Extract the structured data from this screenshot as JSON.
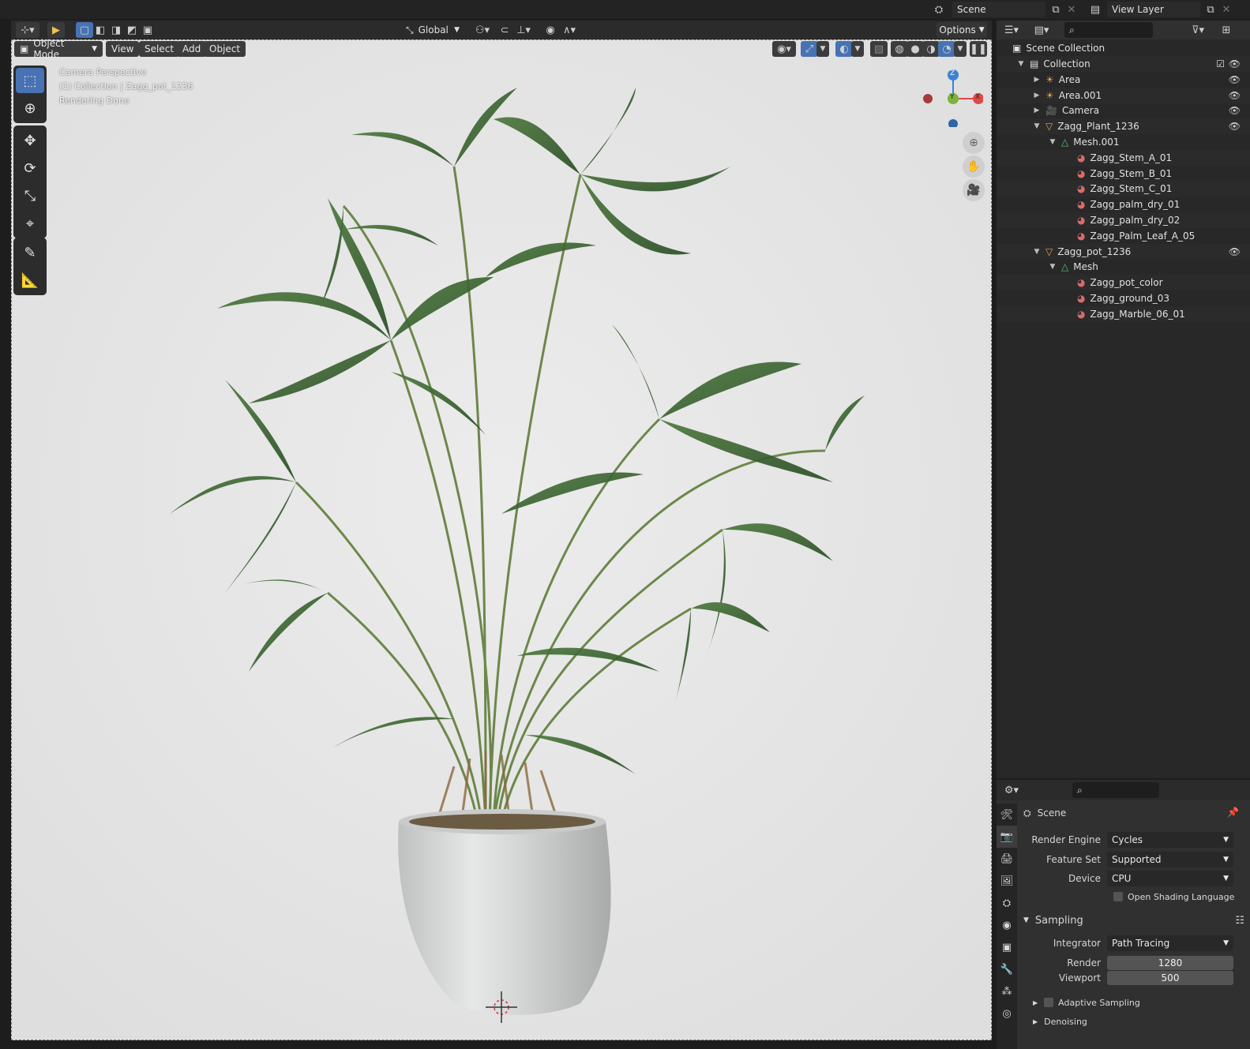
{
  "topbar": {
    "scene_label": "Scene",
    "view_layer_label": "View Layer"
  },
  "header": {
    "transform_orientation": "Global",
    "options_label": "Options"
  },
  "viewport_header": {
    "mode": "Object Mode",
    "menus": [
      "View",
      "Select",
      "Add",
      "Object"
    ]
  },
  "viewport": {
    "info_lines": [
      "Camera Perspective",
      "(1) Collection | Zagg_pot_1236",
      "Rendering Done"
    ],
    "gizmo": {
      "z": "Z",
      "y": "Y",
      "x": "X"
    }
  },
  "outliner": {
    "root": "Scene Collection",
    "rows": [
      {
        "label": "Collection",
        "indent": 1,
        "icon": "collection-icon",
        "expanded": true,
        "eye": true,
        "check": true
      },
      {
        "label": "Area",
        "indent": 2,
        "icon": "light-icon",
        "expanded": false,
        "eye": true
      },
      {
        "label": "Area.001",
        "indent": 2,
        "icon": "light-icon",
        "expanded": false,
        "eye": true
      },
      {
        "label": "Camera",
        "indent": 2,
        "icon": "camera-icon",
        "expanded": false,
        "eye": true
      },
      {
        "label": "Zagg_Plant_1236",
        "indent": 2,
        "icon": "mesh-object-icon",
        "expanded": true,
        "eye": true
      },
      {
        "label": "Mesh.001",
        "indent": 3,
        "icon": "mesh-data-icon",
        "expanded": true
      },
      {
        "label": "Zagg_Stem_A_01",
        "indent": 4,
        "icon": "material-icon"
      },
      {
        "label": "Zagg_Stem_B_01",
        "indent": 4,
        "icon": "material-icon"
      },
      {
        "label": "Zagg_Stem_C_01",
        "indent": 4,
        "icon": "material-icon"
      },
      {
        "label": "Zagg_palm_dry_01",
        "indent": 4,
        "icon": "material-icon"
      },
      {
        "label": "Zagg_palm_dry_02",
        "indent": 4,
        "icon": "material-icon"
      },
      {
        "label": "Zagg_Palm_Leaf_A_05",
        "indent": 4,
        "icon": "material-icon"
      },
      {
        "label": "Zagg_pot_1236",
        "indent": 2,
        "icon": "mesh-object-icon",
        "expanded": true,
        "eye": true
      },
      {
        "label": "Mesh",
        "indent": 3,
        "icon": "mesh-data-icon",
        "expanded": true
      },
      {
        "label": "Zagg_pot_color",
        "indent": 4,
        "icon": "material-icon"
      },
      {
        "label": "Zagg_ground_03",
        "indent": 4,
        "icon": "material-icon"
      },
      {
        "label": "Zagg_Marble_06_01",
        "indent": 4,
        "icon": "material-icon"
      }
    ]
  },
  "properties": {
    "context": "Scene",
    "render_engine_label": "Render Engine",
    "render_engine": "Cycles",
    "feature_set_label": "Feature Set",
    "feature_set": "Supported",
    "device_label": "Device",
    "device": "CPU",
    "osl_label": "Open Shading Language",
    "sampling_header": "Sampling",
    "integrator_label": "Integrator",
    "integrator": "Path Tracing",
    "render_label": "Render",
    "render_samples": "1280",
    "viewport_label": "Viewport",
    "viewport_samples": "500",
    "adaptive_label": "Adaptive Sampling",
    "denoising_label": "Denoising"
  },
  "colors": {
    "accent": "#4772b3",
    "viewport_bg": "#e6e6e6",
    "axis_x": "#e04848",
    "axis_y": "#7bb33b",
    "axis_z": "#3b82d6"
  }
}
